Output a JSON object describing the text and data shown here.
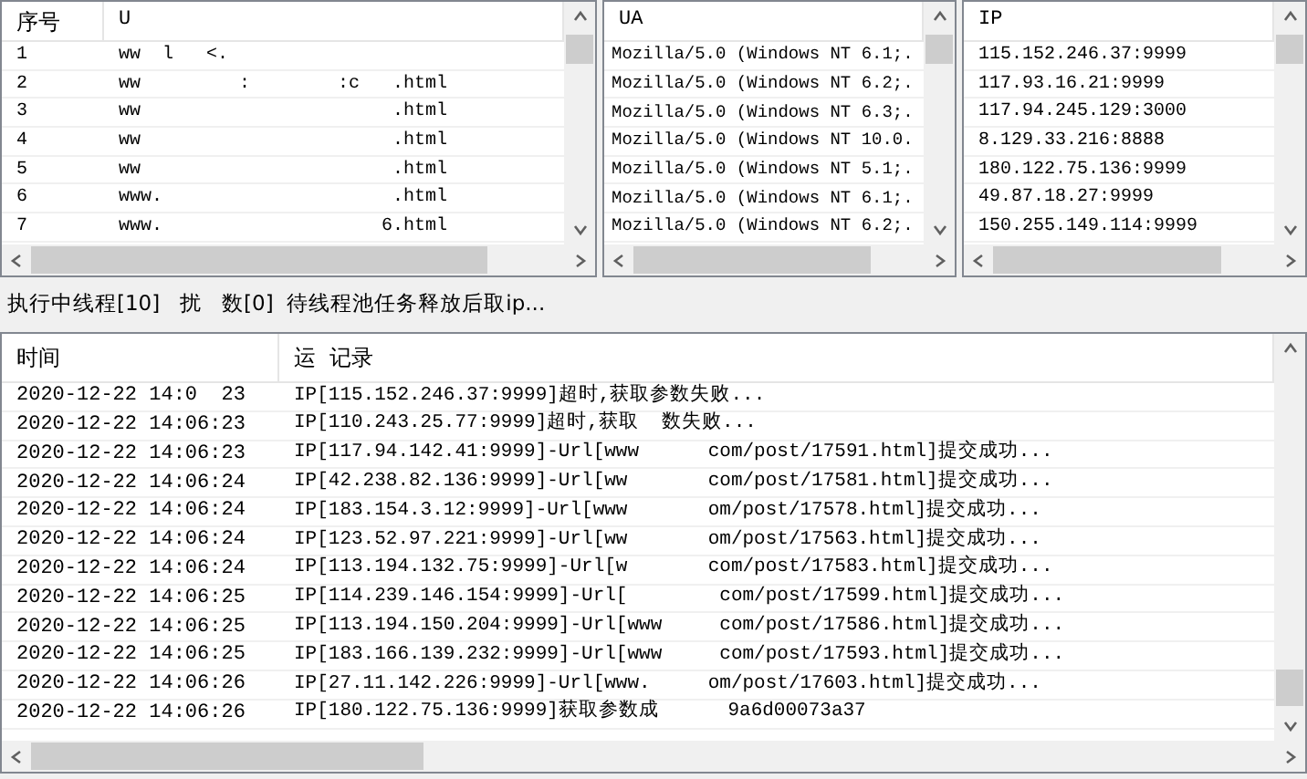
{
  "url_list": {
    "columns": [
      "序号",
      "U"
    ],
    "rows": [
      {
        "index": "1",
        "url": "ww  l   <."
      },
      {
        "index": "2",
        "url": "ww         :        :c   .html"
      },
      {
        "index": "3",
        "url": "ww                       .html"
      },
      {
        "index": "4",
        "url": "ww                       .html"
      },
      {
        "index": "5",
        "url": "ww                       .html"
      },
      {
        "index": "6",
        "url": "www.                     .html"
      },
      {
        "index": "7",
        "url": "www.                    6.html"
      }
    ]
  },
  "ua_list": {
    "columns": [
      "UA"
    ],
    "rows": [
      "Mozilla/5.0 (Windows NT 6.1;.",
      "Mozilla/5.0 (Windows NT 6.2;.",
      "Mozilla/5.0 (Windows NT 6.3;.",
      "Mozilla/5.0 (Windows NT 10.0.",
      "Mozilla/5.0 (Windows NT 5.1;.",
      "Mozilla/5.0 (Windows NT 6.1;.",
      "Mozilla/5.0 (Windows NT 6.2;."
    ]
  },
  "ip_list": {
    "columns": [
      "IP"
    ],
    "rows": [
      "115.152.246.37:9999",
      "117.93.16.21:9999",
      "117.94.245.129:3000",
      "8.129.33.216:8888",
      "180.122.75.136:9999",
      "49.87.18.27:9999",
      "150.255.149.114:9999"
    ]
  },
  "status_text": "执行中线程[10]   扰   数[0]  待线程池任务释放后取ip...",
  "log": {
    "columns": [
      "时间",
      "运  记录"
    ],
    "rows": [
      {
        "time": "2020-12-22 14:0  23",
        "record": "IP[115.152.246.37:9999]超时,获取参数失败..."
      },
      {
        "time": "2020-12-22 14:06:23",
        "record": "IP[110.243.25.77:9999]超时,获取  数失败..."
      },
      {
        "time": "2020-12-22 14:06:23",
        "record": "IP[117.94.142.41:9999]-Url[www      com/post/17591.html]提交成功..."
      },
      {
        "time": "2020-12-22 14:06:24",
        "record": "IP[42.238.82.136:9999]-Url[ww       com/post/17581.html]提交成功..."
      },
      {
        "time": "2020-12-22 14:06:24",
        "record": "IP[183.154.3.12:9999]-Url[www       om/post/17578.html]提交成功..."
      },
      {
        "time": "2020-12-22 14:06:24",
        "record": "IP[123.52.97.221:9999]-Url[ww       om/post/17563.html]提交成功..."
      },
      {
        "time": "2020-12-22 14:06:24",
        "record": "IP[113.194.132.75:9999]-Url[w       com/post/17583.html]提交成功..."
      },
      {
        "time": "2020-12-22 14:06:25",
        "record": "IP[114.239.146.154:9999]-Url[        com/post/17599.html]提交成功..."
      },
      {
        "time": "2020-12-22 14:06:25",
        "record": "IP[113.194.150.204:9999]-Url[www     com/post/17586.html]提交成功..."
      },
      {
        "time": "2020-12-22 14:06:25",
        "record": "IP[183.166.139.232:9999]-Url[www     com/post/17593.html]提交成功..."
      },
      {
        "time": "2020-12-22 14:06:26",
        "record": "IP[27.11.142.226:9999]-Url[www.     om/post/17603.html]提交成功..."
      },
      {
        "time": "2020-12-22 14:06:26",
        "record": "IP[180.122.75.136:9999]获取参数成      9a6d00073a37"
      }
    ]
  }
}
